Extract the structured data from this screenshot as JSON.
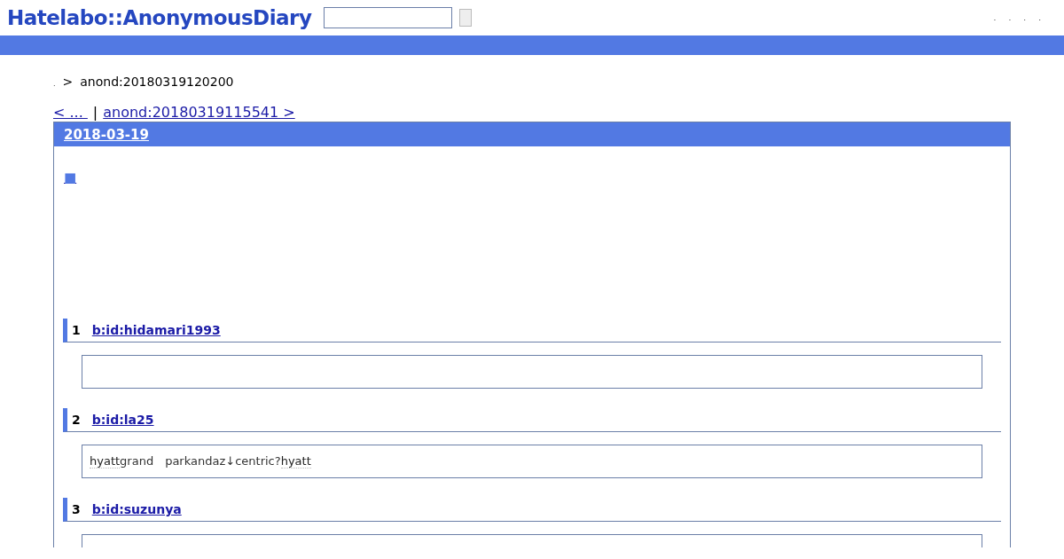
{
  "header": {
    "logo": "Hatelabo::AnonymousDiary",
    "links": [
      ".",
      ".",
      ".",
      "."
    ]
  },
  "breadcrumb": {
    "home": ".",
    "separator": ">",
    "current": "anond:20180319120200"
  },
  "pager": {
    "prev": "< ... ",
    "divider": "|",
    "next": "anond:20180319115541 >"
  },
  "day": {
    "date": "2018-03-19",
    "anchor": "■"
  },
  "comments": [
    {
      "number": "1",
      "user": "b:id:hidamari1993"
    },
    {
      "number": "2",
      "user": "b:id:la25",
      "segments": [
        {
          "text": "hyatt",
          "keyword": true
        },
        {
          "text": "grand　parkandaz↓centric?",
          "keyword": false
        },
        {
          "text": "hyatt",
          "keyword": true
        }
      ]
    },
    {
      "number": "3",
      "user": "b:id:suzunya"
    }
  ]
}
